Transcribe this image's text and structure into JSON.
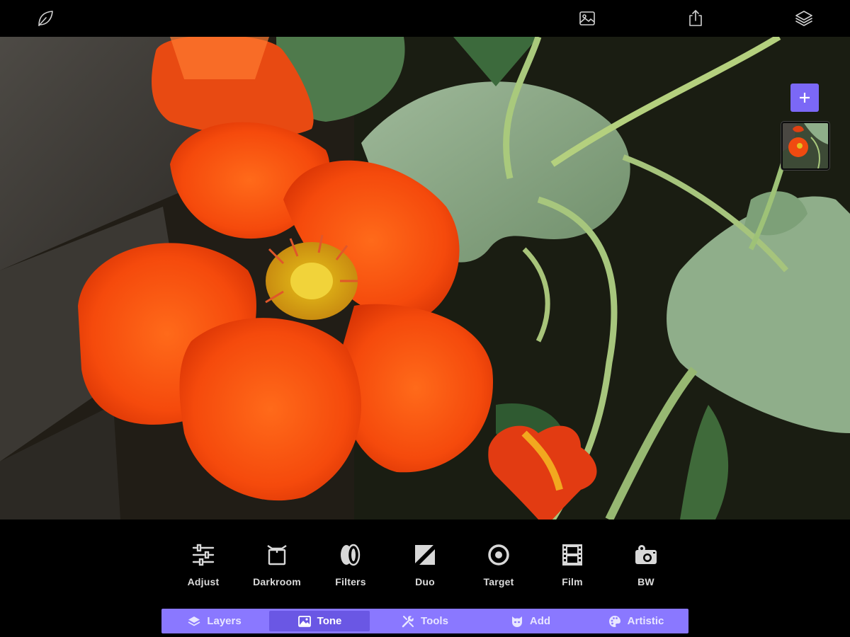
{
  "top_bar": {
    "icons": [
      "leaf-logo-icon",
      "image-icon",
      "share-icon",
      "layers-stack-icon"
    ]
  },
  "canvas": {
    "photo_subject": "orange nasturtium flower",
    "add_layer_icon": "plus-icon",
    "layer_thumbnail_icon": "photo-thumbnail-icon",
    "accent_color": "#7b68f6"
  },
  "history": {
    "undo_icon": "undo-arrow-icon",
    "redo_icon": "redo-arrow-icon"
  },
  "tools": [
    {
      "label": "Adjust",
      "icon": "sliders-icon"
    },
    {
      "label": "Darkroom",
      "icon": "darkroom-icon"
    },
    {
      "label": "Filters",
      "icon": "filters-icon"
    },
    {
      "label": "Duo",
      "icon": "duo-icon"
    },
    {
      "label": "Target",
      "icon": "target-icon"
    },
    {
      "label": "Film",
      "icon": "film-icon"
    },
    {
      "label": "BW",
      "icon": "bw-camera-icon"
    }
  ],
  "tabs": [
    {
      "label": "Layers",
      "icon": "layers-icon",
      "active": false
    },
    {
      "label": "Tone",
      "icon": "tone-icon",
      "active": true
    },
    {
      "label": "Tools",
      "icon": "tools-icon",
      "active": false
    },
    {
      "label": "Add",
      "icon": "add-mask-icon",
      "active": false
    },
    {
      "label": "Artistic",
      "icon": "palette-icon",
      "active": false
    }
  ],
  "colors": {
    "tabbar_bg": "#8a78ff",
    "tab_active_bg": "#6a57e4",
    "tool_icon": "#d8d8d8"
  }
}
